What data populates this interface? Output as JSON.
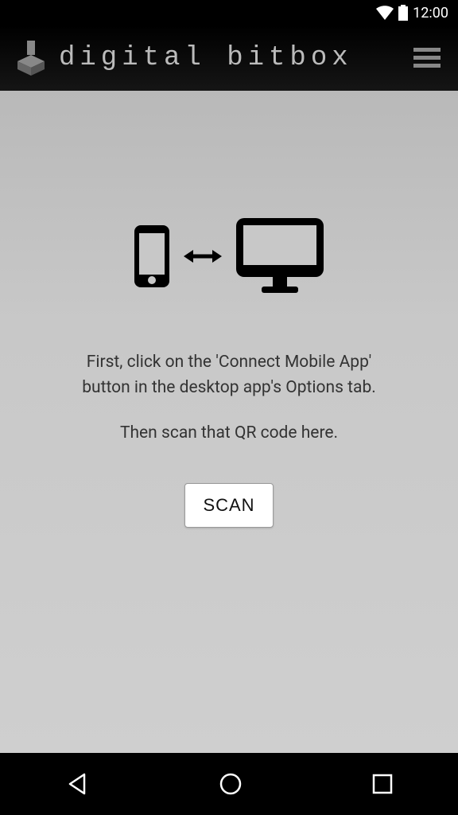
{
  "statusbar": {
    "time": "12:00"
  },
  "header": {
    "title": "digital bitbox"
  },
  "main": {
    "line1": "First, click on the 'Connect Mobile App'",
    "line2": "button in the desktop app's Options tab.",
    "line3": "Then scan that QR code here.",
    "scan_label": "SCAN"
  }
}
